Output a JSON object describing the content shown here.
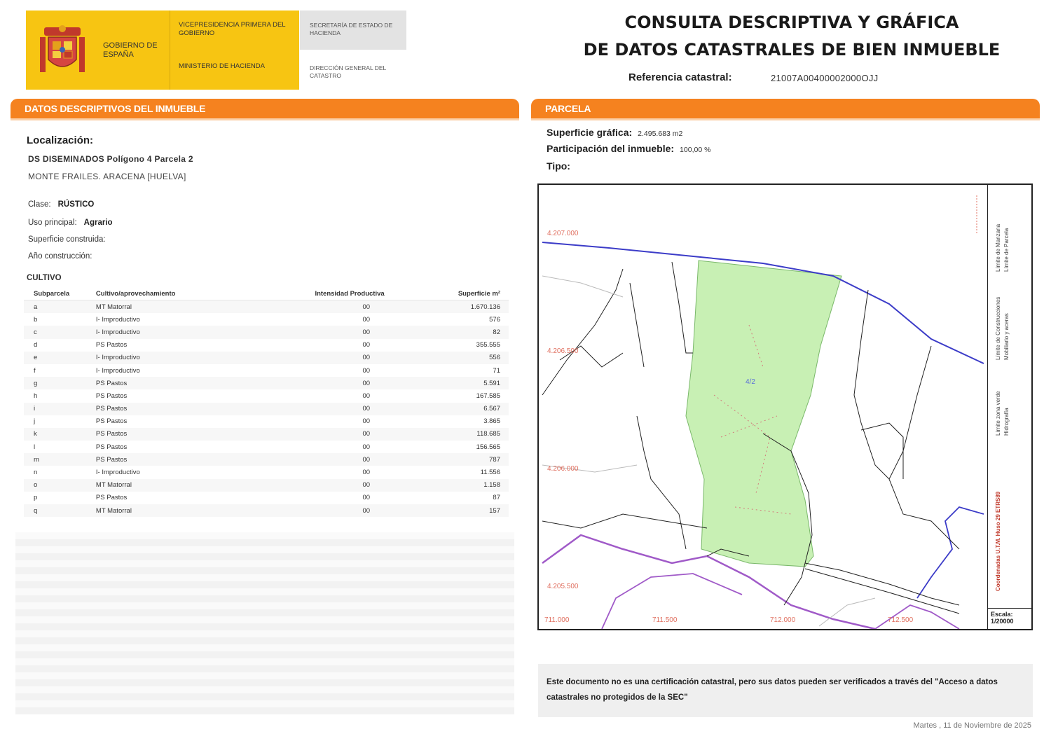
{
  "header": {
    "gobierno": "GOBIERNO DE ESPAÑA",
    "vicepresidencia": "VICEPRESIDENCIA PRIMERA DEL GOBIERNO",
    "ministerio": "MINISTERIO DE HACIENDA",
    "secretaria": "SECRETARÍA DE ESTADO DE HACIENDA",
    "direccion": "DIRECCIÓN GENERAL DEL CATASTRO",
    "title_line1": "CONSULTA DESCRIPTIVA Y GRÁFICA",
    "title_line2": "DE DATOS CATASTRALES DE BIEN INMUEBLE",
    "ref_label": "Referencia catastral:",
    "ref_value": "21007A00400002000OJJ"
  },
  "sections": {
    "left_title": "DATOS DESCRIPTIVOS DEL INMUEBLE",
    "right_title": "PARCELA"
  },
  "inmueble": {
    "loc_title": "Localización:",
    "loc_line1": "DS DISEMINADOS  Polígono 4 Parcela 2",
    "loc_line2": "MONTE FRAILES. ARACENA [HUELVA]",
    "clase_label": "Clase:",
    "clase_value": "RÚSTICO",
    "uso_label": "Uso principal:",
    "uso_value": "Agrario",
    "sup_label": "Superficie construida:",
    "anio_label": "Año construcción:",
    "cultivo_title": "CULTIVO",
    "table_headers": [
      "Subparcela",
      "Cultivo/aprovechamiento",
      "Intensidad Productiva",
      "Superficie m²"
    ],
    "rows": [
      [
        "a",
        "MT Matorral",
        "00",
        "1.670.136"
      ],
      [
        "b",
        "I- Improductivo",
        "00",
        "576"
      ],
      [
        "c",
        "I- Improductivo",
        "00",
        "82"
      ],
      [
        "d",
        "PS Pastos",
        "00",
        "355.555"
      ],
      [
        "e",
        "I- Improductivo",
        "00",
        "556"
      ],
      [
        "f",
        "I- Improductivo",
        "00",
        "71"
      ],
      [
        "g",
        "PS Pastos",
        "00",
        "5.591"
      ],
      [
        "h",
        "PS Pastos",
        "00",
        "167.585"
      ],
      [
        "i",
        "PS Pastos",
        "00",
        "6.567"
      ],
      [
        "j",
        "PS Pastos",
        "00",
        "3.865"
      ],
      [
        "k",
        "PS Pastos",
        "00",
        "118.685"
      ],
      [
        "l",
        "PS Pastos",
        "00",
        "156.565"
      ],
      [
        "m",
        "PS Pastos",
        "00",
        "787"
      ],
      [
        "n",
        "I- Improductivo",
        "00",
        "11.556"
      ],
      [
        "o",
        "MT Matorral",
        "00",
        "1.158"
      ],
      [
        "p",
        "PS Pastos",
        "00",
        "87"
      ],
      [
        "q",
        "MT Matorral",
        "00",
        "157"
      ]
    ]
  },
  "parcela": {
    "sup_label": "Superficie gráfica:",
    "sup_value": "2.495.683 m2",
    "part_label": "Participación del inmueble:",
    "part_value": "100,00 %",
    "tipo_label": "Tipo:",
    "coords_y": [
      "4.207.000",
      "4.206.500",
      "4.206.000",
      "4.205.500"
    ],
    "coords_x": [
      "711.000",
      "711.500",
      "712.000",
      "712.500"
    ],
    "parcel_label": "4/2",
    "legend_main": "Coordenadas U.T.M. Huso 29 ETRS89",
    "legend_lines": [
      "Límite de Manzana",
      "Límite de Parcela",
      "Límite de Construcciones",
      "Mobiliario y aceras",
      "Límite zona verde",
      "Hidrografía"
    ],
    "scale_label": "Escala:",
    "scale_value": "1/20000",
    "colors": {
      "parcel_fill": "#c8f0b4",
      "boundary_blue": "#3c3cc8",
      "road_purple": "#a05ac8"
    }
  },
  "note": "Este documento no es una certificación catastral, pero sus datos pueden ser verificados a través del \"Acceso a datos catastrales no protegidos de la SEC\"",
  "footer": "Martes , 11 de Noviembre de 2025"
}
